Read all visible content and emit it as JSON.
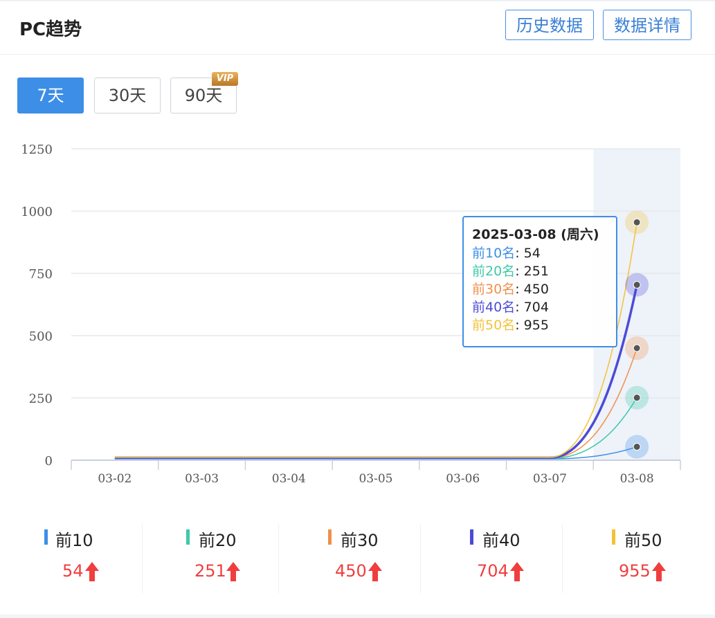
{
  "header": {
    "title": "PC趋势",
    "history_button": "历史数据",
    "detail_button": "数据详情"
  },
  "ranges": {
    "r7": "7天",
    "r30": "30天",
    "r90": "90天",
    "vip_badge": "VIP",
    "active": "7天"
  },
  "colors": {
    "accent": "#3d8ee6",
    "up": "#f03e3e"
  },
  "chart_data": {
    "type": "line",
    "categories": [
      "03-02",
      "03-03",
      "03-04",
      "03-05",
      "03-06",
      "03-07",
      "03-08"
    ],
    "y_ticks": [
      "0",
      "250",
      "500",
      "750",
      "1000",
      "1250"
    ],
    "ylim": [
      0,
      1250
    ],
    "grid": true,
    "highlight_category": "03-08",
    "series": [
      {
        "name": "前10名",
        "color": "#3d8ee6",
        "values": [
          0,
          0,
          0,
          0,
          0,
          0,
          54
        ]
      },
      {
        "name": "前20名",
        "color": "#3ec9a7",
        "values": [
          0,
          0,
          0,
          0,
          0,
          0,
          251
        ]
      },
      {
        "name": "前30名",
        "color": "#f0904a",
        "values": [
          0,
          0,
          0,
          0,
          0,
          0,
          450
        ]
      },
      {
        "name": "前40名",
        "color": "#4b4bd6",
        "values": [
          0,
          0,
          0,
          0,
          0,
          0,
          704
        ]
      },
      {
        "name": "前50名",
        "color": "#f4c236",
        "values": [
          0,
          0,
          0,
          0,
          0,
          0,
          955
        ]
      }
    ],
    "tooltip": {
      "date": "2025-03-08 (周六)",
      "rows": [
        {
          "label": "前10名",
          "value": "54"
        },
        {
          "label": "前20名",
          "value": "251"
        },
        {
          "label": "前30名",
          "value": "450"
        },
        {
          "label": "前40名",
          "value": "704"
        },
        {
          "label": "前50名",
          "value": "955"
        }
      ]
    }
  },
  "stats": [
    {
      "label": "前10",
      "value": "54",
      "color": "#3d8ee6"
    },
    {
      "label": "前20",
      "value": "251",
      "color": "#3ec9a7"
    },
    {
      "label": "前30",
      "value": "450",
      "color": "#f0904a"
    },
    {
      "label": "前40",
      "value": "704",
      "color": "#4b4bd6"
    },
    {
      "label": "前50",
      "value": "955",
      "color": "#f4c236"
    }
  ]
}
